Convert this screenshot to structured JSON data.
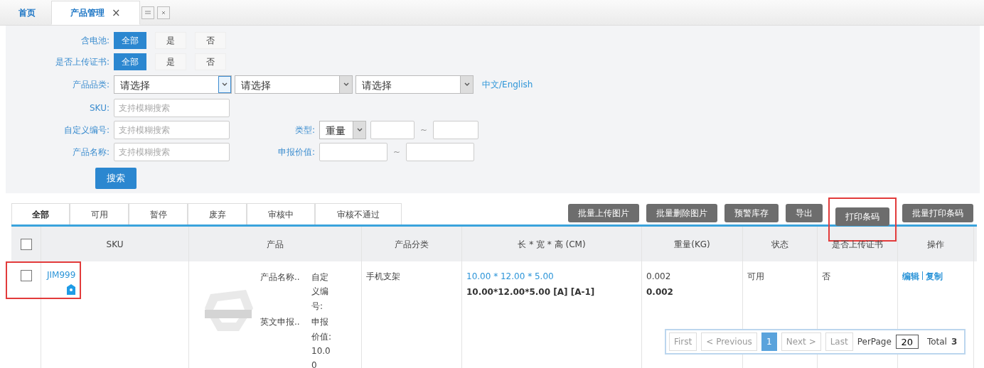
{
  "tabs": [
    {
      "label": "首页",
      "selected": false
    },
    {
      "label": "产品管理",
      "selected": true,
      "close_label": "×"
    }
  ],
  "toggle_filters": [
    {
      "label": "含电池:",
      "options": [
        {
          "label": "全部",
          "selected": true
        },
        {
          "label": "是",
          "selected": false
        },
        {
          "label": "否",
          "selected": false
        }
      ]
    },
    {
      "label": "是否上传证书:",
      "options": [
        {
          "label": "全部",
          "selected": true
        },
        {
          "label": "是",
          "selected": false
        },
        {
          "label": "否",
          "selected": false
        }
      ]
    }
  ],
  "category": {
    "label": "产品品类:",
    "selects": [
      {
        "value": "请选择",
        "focused": true
      },
      {
        "value": "请选择",
        "focused": false
      },
      {
        "value": "请选择",
        "focused": false
      }
    ],
    "language_link": "中文/English"
  },
  "text_filters": [
    {
      "label": "SKU:",
      "placeholder": "支持模糊搜索"
    },
    {
      "label": "自定义编号:",
      "placeholder": "支持模糊搜索"
    },
    {
      "label": "产品名称:",
      "placeholder": "支持模糊搜索"
    }
  ],
  "range_filters": [
    {
      "label": "类型:",
      "kind": "select-range",
      "select": "重量",
      "separator": "~"
    },
    {
      "label": "申报价值:",
      "kind": "range",
      "separator": "~"
    }
  ],
  "search_button": "搜索",
  "status_tabs": [
    {
      "label": "全部",
      "selected": true
    },
    {
      "label": "可用",
      "selected": false
    },
    {
      "label": "暂停",
      "selected": false
    },
    {
      "label": "废弃",
      "selected": false
    },
    {
      "label": "审核中",
      "selected": false
    },
    {
      "label": "审核不通过",
      "selected": false
    }
  ],
  "action_buttons": [
    {
      "label": "批量上传图片",
      "highlighted": false
    },
    {
      "label": "批量删除图片",
      "highlighted": false
    },
    {
      "label": "预警库存",
      "highlighted": false
    },
    {
      "label": "导出",
      "highlighted": false
    },
    {
      "label": "打印条码",
      "highlighted": true
    },
    {
      "label": "批量打印条码",
      "highlighted": false
    }
  ],
  "table": {
    "select_all_checked": false,
    "columns": [
      "SKU",
      "产品",
      "产品分类",
      "长 * 宽 * 高 (CM)",
      "重量(KG)",
      "状态",
      "是否上传证书",
      "操作"
    ],
    "rows": [
      {
        "checked": false,
        "highlighted": true,
        "sku": "JIM999",
        "product_fields": [
          {
            "label": "产品名称..",
            "value": "自定义编号:"
          },
          {
            "label": "英文申报..",
            "value": "申报价值: 10.00"
          }
        ],
        "category": "手机支架",
        "dimensions": "10.00 * 12.00 * 5.00",
        "dimensions_detail": "10.00*12.00*5.00 [A] [A-1]",
        "weight": "0.002",
        "weight_detail": "0.002",
        "status": "可用",
        "certificate": "否",
        "actions": [
          "编辑",
          "复制"
        ]
      }
    ]
  },
  "pagination": {
    "first": "First",
    "previous": "< Previous",
    "pages": [
      {
        "label": "1",
        "selected": true
      }
    ],
    "next": "Next >",
    "last": "Last",
    "per_page_label": "PerPage",
    "per_page": "20",
    "total_label": "Total",
    "total": "3"
  }
}
